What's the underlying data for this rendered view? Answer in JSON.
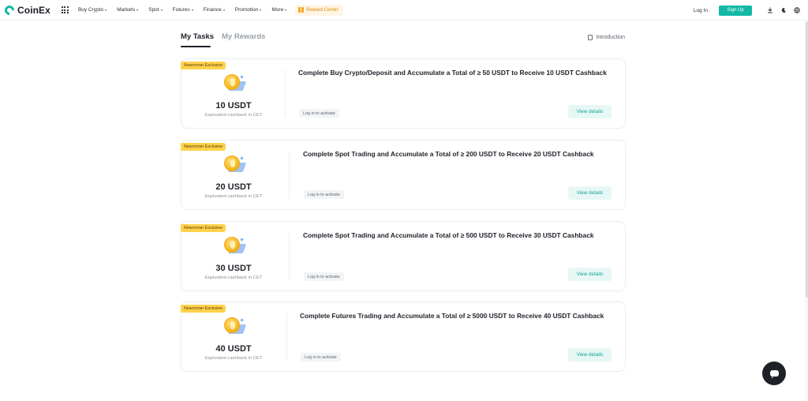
{
  "header": {
    "logo_text": "CoinEx",
    "nav": [
      {
        "label": "Buy Crypto",
        "name": "nav-buy-crypto"
      },
      {
        "label": "Markets",
        "name": "nav-markets"
      },
      {
        "label": "Spot",
        "name": "nav-spot"
      },
      {
        "label": "Futures",
        "name": "nav-futures"
      },
      {
        "label": "Finance",
        "name": "nav-finance"
      },
      {
        "label": "Promotion",
        "name": "nav-promotion"
      },
      {
        "label": "More",
        "name": "nav-more"
      }
    ],
    "reward_center": "Reward Center",
    "login": "Log In",
    "signup": "Sign Up"
  },
  "tabs": {
    "my_tasks": "My Tasks",
    "my_rewards": "My Rewards",
    "introduction": "Introduction"
  },
  "tasks": [
    {
      "badge": "Newcomer Exclusive",
      "amount": "10 USDT",
      "sub": "Equivalent cashback in CET",
      "title": "Complete Buy Crypto/Deposit and Accumulate a Total of ≥ 50 USDT to Receive 10 USDT Cashback",
      "status": "Log in to activate",
      "button": "View details"
    },
    {
      "badge": "Newcomer Exclusive",
      "amount": "20 USDT",
      "sub": "Equivalent cashback in CET",
      "title": "Complete Spot Trading and Accumulate a Total of ≥ 200 USDT to Receive 20 USDT Cashback",
      "status": "Log in to activate",
      "button": "View details"
    },
    {
      "badge": "Newcomer Exclusive",
      "amount": "30 USDT",
      "sub": "Equivalent cashback in CET",
      "title": "Complete Spot Trading and Accumulate a Total of ≥ 500 USDT to Receive 30 USDT Cashback",
      "status": "Log in to activate",
      "button": "View details"
    },
    {
      "badge": "Newcomer Exclusive",
      "amount": "40 USDT",
      "sub": "Equivalent cashback in CET",
      "title": "Complete Futures Trading and Accumulate a Total of ≥ 5000 USDT to Receive 40 USDT Cashback",
      "status": "Log in to activate",
      "button": "View details"
    }
  ],
  "colors": {
    "brand": "#12b8a6",
    "badge": "#ffd24c",
    "button_bg": "#e7f7f5"
  }
}
